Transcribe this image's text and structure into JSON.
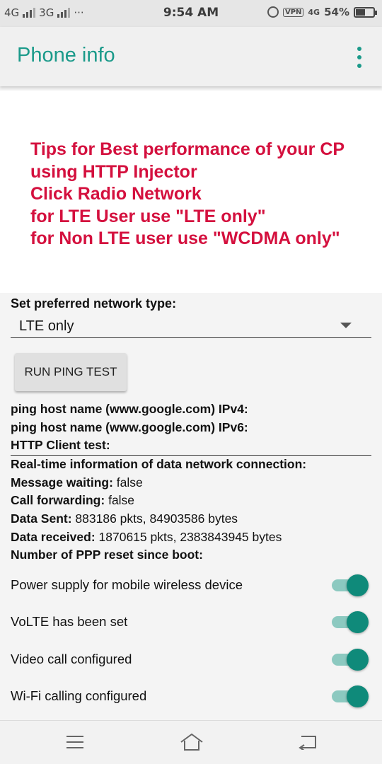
{
  "status_bar": {
    "net1": "4G",
    "net2": "3G",
    "more": "···",
    "time": "9:54 AM",
    "vpn": "VPN",
    "net3": "4G",
    "battery": "54%",
    "battery_level": 0.54
  },
  "app_bar": {
    "title": "Phone info",
    "menu_icon": "overflow-menu-icon"
  },
  "tips": {
    "lines": [
      "Tips for Best performance of your CP",
      "using HTTP Injector",
      "Click Radio Network",
      "for LTE User use \"LTE only\"",
      "for Non LTE user use \"WCDMA only\""
    ],
    "color": "#d4103e"
  },
  "network_type": {
    "label": "Set preferred network type:",
    "selected": "LTE only"
  },
  "ping_button": {
    "label": "RUN PING TEST"
  },
  "info": {
    "ipv4": "ping host name (www.google.com) IPv4:",
    "ipv6": "ping host name (www.google.com) IPv6:",
    "http": "HTTP Client test:",
    "realtime": "Real-time information of data network connection:",
    "msg_label": "Message waiting:",
    "msg_value": "false",
    "fwd_label": "Call forwarding:",
    "fwd_value": "false",
    "sent_label": "Data Sent:",
    "sent_value": "883186 pkts, 84903586 bytes",
    "recv_label": "Data received:",
    "recv_value": "1870615 pkts, 2383843945 bytes",
    "ppp_label": "Number of PPP reset since boot:"
  },
  "toggles": [
    {
      "label": "Power supply for mobile wireless device",
      "on": true
    },
    {
      "label": "VoLTE has been set",
      "on": true
    },
    {
      "label": "Video call configured",
      "on": true
    },
    {
      "label": "Wi-Fi calling configured",
      "on": true
    }
  ],
  "colors": {
    "accent": "#1b9a8a",
    "switch_thumb": "#0f8a7a",
    "switch_track": "#8cc9c0"
  }
}
